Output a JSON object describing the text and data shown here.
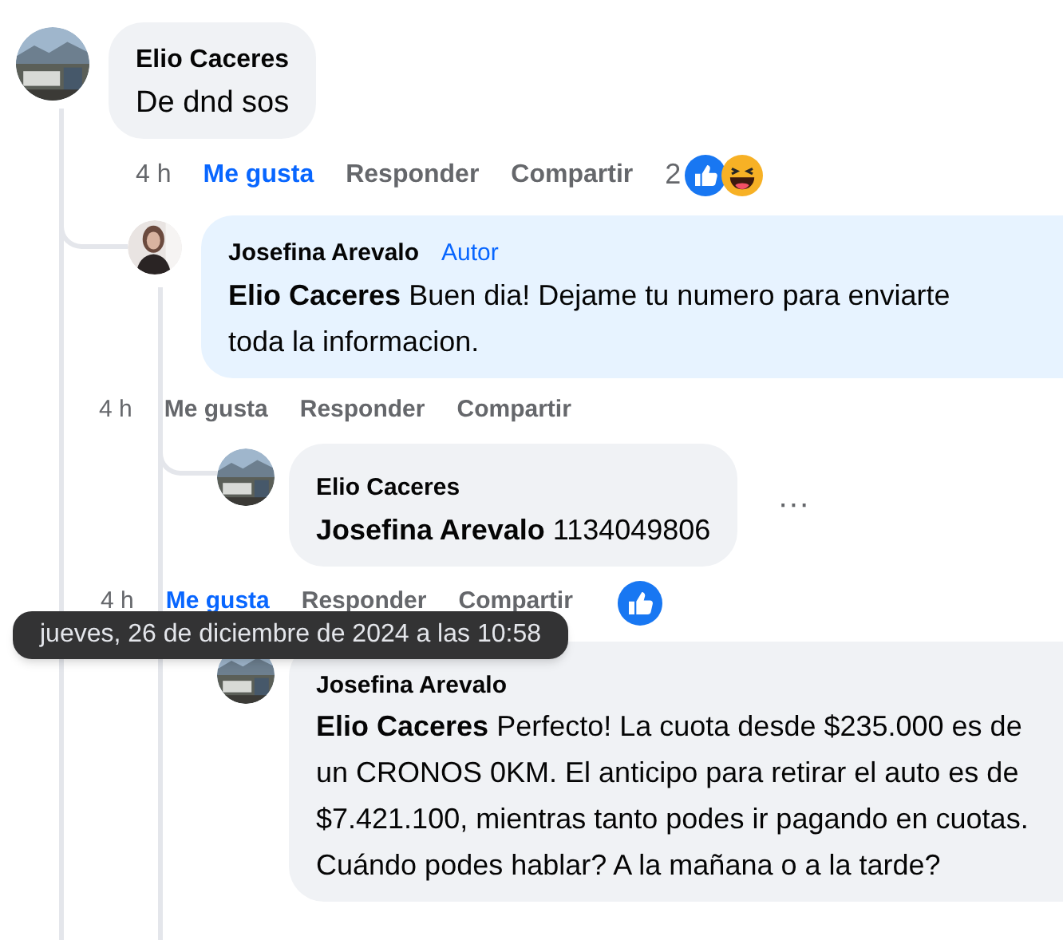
{
  "comments": [
    {
      "author": "Elio Caceres",
      "text": "De dnd sos",
      "time": "4 h",
      "liked": true,
      "actions": [
        "Me gusta",
        "Responder",
        "Compartir"
      ],
      "reaction_count": "2",
      "reactions": [
        {
          "kind": "like"
        },
        {
          "kind": "haha"
        }
      ],
      "children": [
        {
          "author": "Josefina Arevalo",
          "badge": "Autor",
          "highlighted": true,
          "mention": "Elio Caceres",
          "text": "Buen dia! Dejame tu numero para enviarte toda la informacion.",
          "time": "4 h",
          "liked": false,
          "actions": [
            "Me gusta",
            "Responder",
            "Compartir"
          ],
          "children": [
            {
              "author": "Elio Caceres",
              "mention": "Josefina Arevalo",
              "text": "1134049806",
              "more": "···",
              "time": "4 h",
              "liked": true,
              "actions": [
                "Me gusta",
                "Responder",
                "Compartir"
              ],
              "reactions": [
                {
                  "kind": "like"
                }
              ]
            },
            {
              "author": "Josefina Arevalo",
              "mention": "Elio Caceres",
              "text": "Perfecto! La cuota desde $235.000 es de un CRONOS 0KM. El anticipo para retirar el auto es de $7.421.100, mientras tanto podes ir pagando en cuotas. Cuándo podes hablar? A la mañana o a la tarde?"
            }
          ]
        }
      ]
    }
  ],
  "tooltip": "jueves, 26 de diciembre de 2024 a las 10:58"
}
